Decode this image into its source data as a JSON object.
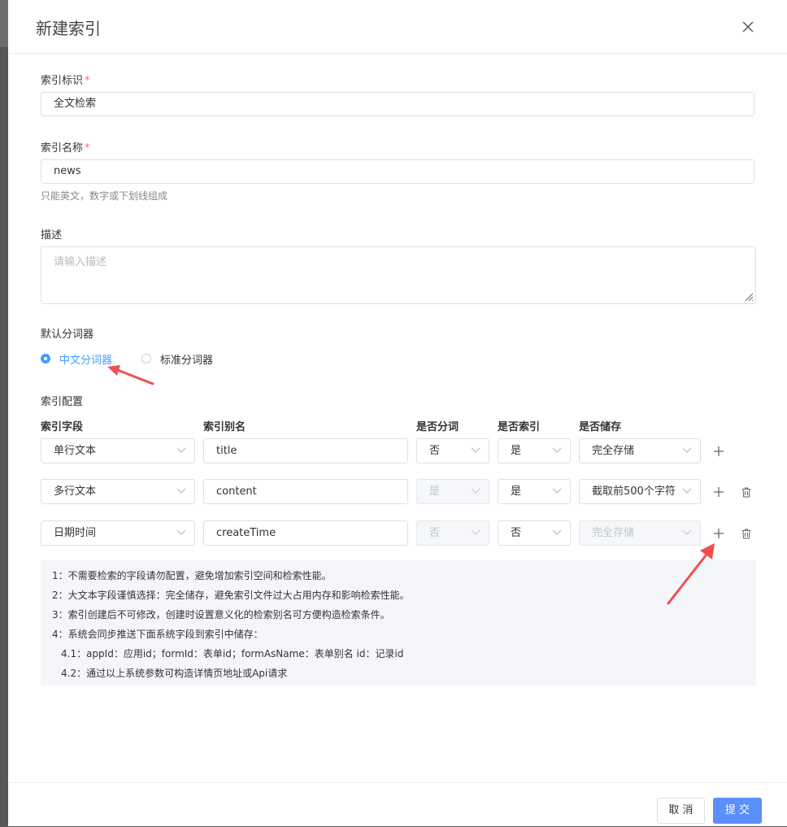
{
  "dialog": {
    "title": "新建索引"
  },
  "form": {
    "index_id": {
      "label": "索引标识",
      "required_mark": "*",
      "value": "全文检索"
    },
    "index_name": {
      "label": "索引名称",
      "required_mark": "*",
      "value": "news",
      "hint": "只能英文，数字或下划线组成"
    },
    "description": {
      "label": "描述",
      "placeholder": "请输入描述"
    },
    "tokenizer": {
      "label": "默认分词器",
      "options": [
        {
          "label": "中文分词器",
          "selected": true
        },
        {
          "label": "标准分词器",
          "selected": false
        }
      ]
    }
  },
  "index_config": {
    "label": "索引配置",
    "columns": [
      "索引字段",
      "索引别名",
      "是否分词",
      "是否索引",
      "是否储存"
    ],
    "rows": [
      {
        "field": "单行文本",
        "alias": "title",
        "tokenize": "否",
        "index": "是",
        "store": "完全存储",
        "tokenize_disabled": false,
        "store_disabled": false,
        "deletable": false
      },
      {
        "field": "多行文本",
        "alias": "content",
        "tokenize": "是",
        "index": "是",
        "store": "截取前500个字符",
        "tokenize_disabled": true,
        "store_disabled": false,
        "deletable": true
      },
      {
        "field": "日期时间",
        "alias": "createTime",
        "tokenize": "否",
        "index": "否",
        "store": "完全存储",
        "tokenize_disabled": true,
        "store_disabled": true,
        "deletable": true
      }
    ]
  },
  "notes": [
    "1：不需要检索的字段请勿配置，避免增加索引空间和检索性能。",
    "2：大文本字段谨慎选择：完全储存，避免索引文件过大占用内存和影响检索性能。",
    "3：索引创建后不可修改，创建时设置意义化的检索别名可方便构造检索条件。",
    "4：系统会同步推送下面系统字段到索引中储存：",
    "4.1：appId：应用id；formId：表单id；formAsName：表单别名 id：记录id",
    "4.2：通过以上系统参数可构造详情页地址或Api请求"
  ],
  "footer": {
    "cancel_label": "取 消",
    "submit_label": "提 交"
  },
  "colors": {
    "accent": "#409eff",
    "submit": "#5b8ff9",
    "required": "#f56c6c",
    "annotation_arrow": "#f24e4e"
  }
}
